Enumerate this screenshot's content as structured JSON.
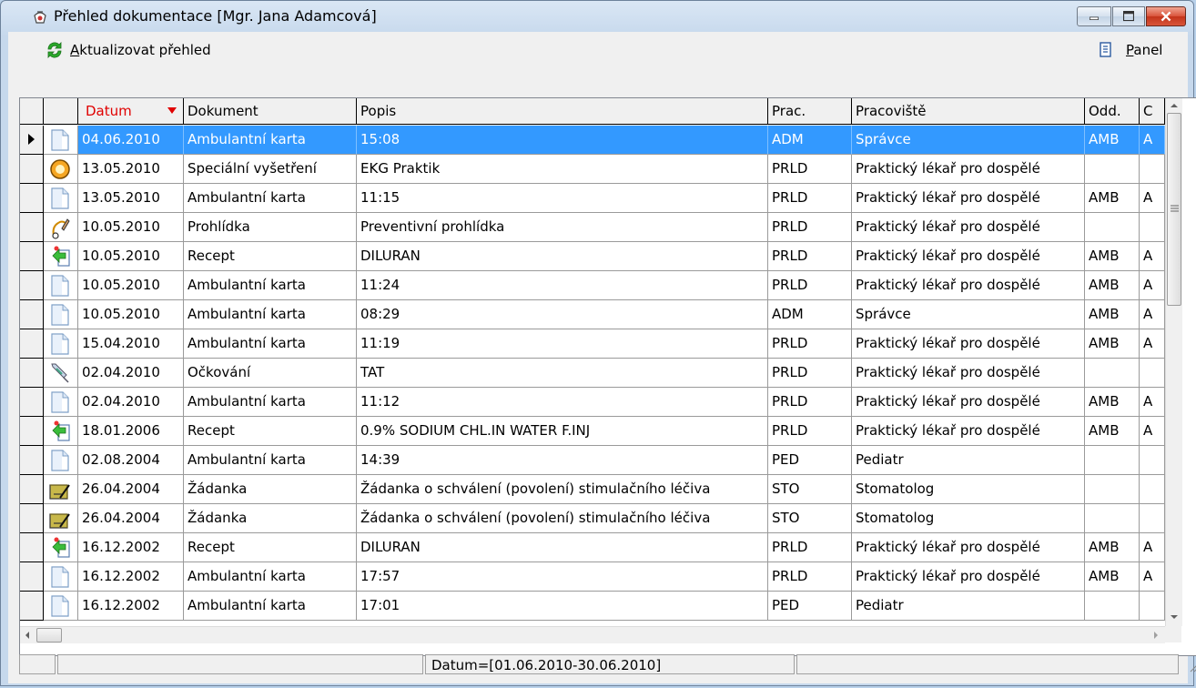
{
  "window": {
    "title": "Přehled dokumentace [Mgr. Jana Adamcová]"
  },
  "toolbar": {
    "refresh": {
      "pre": "",
      "accel": "A",
      "rest": "ktualizovat přehled",
      "icon": "refresh-icon"
    },
    "panel": {
      "pre": "",
      "accel": "P",
      "rest": "anel",
      "icon": "panel-icon"
    }
  },
  "grid": {
    "columns": [
      {
        "key": "datum",
        "label": "Datum",
        "sorted": "desc"
      },
      {
        "key": "dokument",
        "label": "Dokument"
      },
      {
        "key": "popis",
        "label": "Popis"
      },
      {
        "key": "prac",
        "label": "Prac."
      },
      {
        "key": "pracoviste",
        "label": "Pracoviště"
      },
      {
        "key": "odd",
        "label": "Odd."
      },
      {
        "key": "c",
        "label": "C"
      }
    ],
    "rows": [
      {
        "icon": "document-icon",
        "datum": "04.06.2010",
        "dokument": "Ambulantní karta",
        "popis": "15:08",
        "prac": "ADM",
        "pracoviste": "Správce",
        "odd": "AMB",
        "c": "A",
        "selected": true
      },
      {
        "icon": "special-exam-icon",
        "datum": "13.05.2010",
        "dokument": "Speciální vyšetření",
        "popis": "EKG Praktik",
        "prac": "PRLD",
        "pracoviste": "Praktický lékař pro dospělé",
        "odd": "",
        "c": ""
      },
      {
        "icon": "document-icon",
        "datum": "13.05.2010",
        "dokument": "Ambulantní karta",
        "popis": "11:15",
        "prac": "PRLD",
        "pracoviste": "Praktický lékař pro dospělé",
        "odd": "AMB",
        "c": "A"
      },
      {
        "icon": "examination-icon",
        "datum": "10.05.2010",
        "dokument": "Prohlídka",
        "popis": "Preventivní prohlídka",
        "prac": "PRLD",
        "pracoviste": "Praktický lékař pro dospělé",
        "odd": "",
        "c": ""
      },
      {
        "icon": "prescription-icon",
        "datum": "10.05.2010",
        "dokument": "Recept",
        "popis": "DILURAN",
        "prac": "PRLD",
        "pracoviste": "Praktický lékař pro dospělé",
        "odd": "AMB",
        "c": "A"
      },
      {
        "icon": "document-icon",
        "datum": "10.05.2010",
        "dokument": "Ambulantní karta",
        "popis": "11:24",
        "prac": "PRLD",
        "pracoviste": "Praktický lékař pro dospělé",
        "odd": "AMB",
        "c": "A"
      },
      {
        "icon": "document-icon",
        "datum": "10.05.2010",
        "dokument": "Ambulantní karta",
        "popis": "08:29",
        "prac": "ADM",
        "pracoviste": "Správce",
        "odd": "AMB",
        "c": "A"
      },
      {
        "icon": "document-icon",
        "datum": "15.04.2010",
        "dokument": "Ambulantní karta",
        "popis": "11:19",
        "prac": "PRLD",
        "pracoviste": "Praktický lékař pro dospělé",
        "odd": "AMB",
        "c": "A"
      },
      {
        "icon": "vaccination-icon",
        "datum": "02.04.2010",
        "dokument": "Očkování",
        "popis": "TAT",
        "prac": "PRLD",
        "pracoviste": "Praktický lékař pro dospělé",
        "odd": "",
        "c": ""
      },
      {
        "icon": "document-icon",
        "datum": "02.04.2010",
        "dokument": "Ambulantní karta",
        "popis": "11:12",
        "prac": "PRLD",
        "pracoviste": "Praktický lékař pro dospělé",
        "odd": "AMB",
        "c": "A"
      },
      {
        "icon": "prescription-icon",
        "datum": "18.01.2006",
        "dokument": "Recept",
        "popis": "0.9% SODIUM CHL.IN WATER F.INJ",
        "prac": "PRLD",
        "pracoviste": "Praktický lékař pro dospělé",
        "odd": "AMB",
        "c": "A"
      },
      {
        "icon": "document-icon",
        "datum": "02.08.2004",
        "dokument": "Ambulantní karta",
        "popis": "14:39",
        "prac": "PED",
        "pracoviste": "Pediatr",
        "odd": "",
        "c": ""
      },
      {
        "icon": "request-icon",
        "datum": "26.04.2004",
        "dokument": "Žádanka",
        "popis": "Žádanka o schválení (povolení) stimulačního léčiva",
        "prac": "STO",
        "pracoviste": "Stomatolog",
        "odd": "",
        "c": ""
      },
      {
        "icon": "request-icon",
        "datum": "26.04.2004",
        "dokument": "Žádanka",
        "popis": "Žádanka o schválení (povolení) stimulačního léčiva",
        "prac": "STO",
        "pracoviste": "Stomatolog",
        "odd": "",
        "c": ""
      },
      {
        "icon": "prescription-icon",
        "datum": "16.12.2002",
        "dokument": "Recept",
        "popis": "DILURAN",
        "prac": "PRLD",
        "pracoviste": "Praktický lékař pro dospělé",
        "odd": "AMB",
        "c": "A"
      },
      {
        "icon": "document-icon",
        "datum": "16.12.2002",
        "dokument": "Ambulantní karta",
        "popis": "17:57",
        "prac": "PRLD",
        "pracoviste": "Praktický lékař pro dospělé",
        "odd": "AMB",
        "c": "A"
      },
      {
        "icon": "document-icon",
        "datum": "16.12.2002",
        "dokument": "Ambulantní karta",
        "popis": "17:01",
        "prac": "PED",
        "pracoviste": "Pediatr",
        "odd": "",
        "c": ""
      }
    ]
  },
  "statusbar": {
    "panel1": "",
    "panel2": "",
    "filter": "Datum=[01.06.2010-30.06.2010]",
    "panel4": ""
  },
  "colors": {
    "selection": "#3399ff",
    "sort_indicator": "#e00000",
    "close_button": "#c3341b"
  }
}
